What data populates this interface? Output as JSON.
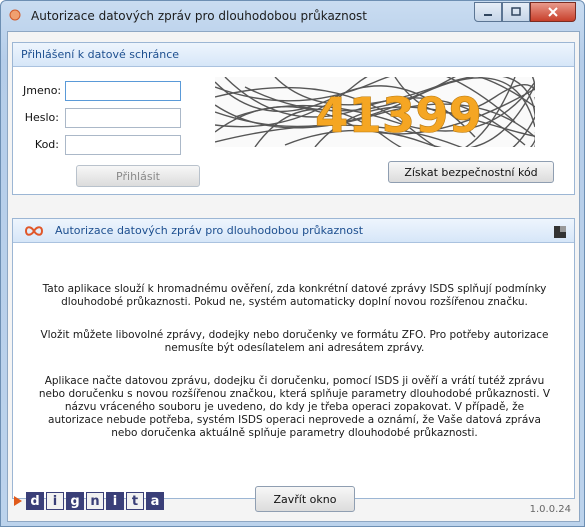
{
  "window": {
    "title": "Autorizace datových zpráv pro dlouhodobou průkaznost",
    "controls": [
      "minimize",
      "maximize",
      "close"
    ]
  },
  "login": {
    "header": "Přihlášení k datové schránce",
    "fields": [
      {
        "label": "Jmeno:",
        "value": ""
      },
      {
        "label": "Heslo:",
        "value": ""
      },
      {
        "label": "Kod:",
        "value": ""
      }
    ],
    "login_button": "Přihlásit",
    "captcha_text": "41399",
    "get_code_button": "Získat bezpečnostní kód"
  },
  "auth": {
    "header": "Autorizace datových zpráv pro dlouhodobou průkaznost",
    "paragraphs": [
      "Tato aplikace slouží k hromadnému ověření, zda konkrétní datové zprávy ISDS splňují podmínky dlouhodobé průkaznosti. Pokud ne, systém automaticky doplní novou rozšířenou značku.",
      "Vložit můžete libovolné zprávy, dodejky nebo doručenky ve formátu ZFO. Pro potřeby autorizace nemusíte být odesílatelem ani adresátem zprávy.",
      "Aplikace načte datovou zprávu, dodejku či doručenku, pomocí ISDS ji ověří a vrátí tutéž zprávu nebo doručenku s novou rozšířenou značkou, která splňuje parametry dlouhodobé průkaznosti. V názvu vráceného souboru je uvedeno, do kdy je třeba operaci zopakovat. V případě, že autorizace nebude potřeba, systém ISDS operaci neprovede a oznámí, že Vaše datová zpráva nebo doručenka aktuálně splňuje parametry dlouhodobé průkaznosti."
    ]
  },
  "footer": {
    "close_button": "Zavřít okno",
    "version": "1.0.0.24",
    "brand_letters": [
      "d",
      "i",
      "g",
      "n",
      "i",
      "t",
      "a"
    ]
  },
  "colors": {
    "accent": "#1d4f8f",
    "brand": "#3a3f78",
    "captcha_text": "#f5a623"
  }
}
